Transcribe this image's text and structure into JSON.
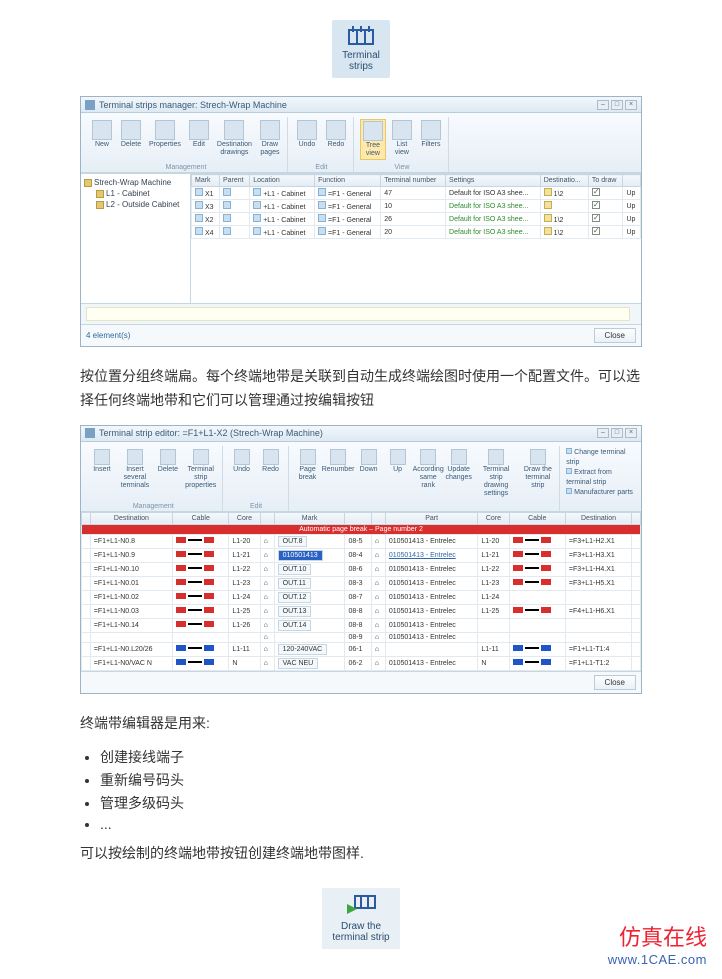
{
  "top_icon": {
    "label": "Terminal\nstrips"
  },
  "manager": {
    "title": "Terminal strips manager: Strech-Wrap Machine",
    "ribbon": {
      "groups": [
        {
          "label": "Management",
          "buttons": [
            {
              "label": "New"
            },
            {
              "label": "Delete"
            },
            {
              "label": "Properties"
            },
            {
              "label": "Edit"
            },
            {
              "label": "Destination\ndrawings"
            },
            {
              "label": "Draw\npages"
            }
          ]
        },
        {
          "label": "Edit",
          "buttons": [
            {
              "label": "Undo"
            },
            {
              "label": "Redo"
            }
          ]
        },
        {
          "label": "View",
          "buttons": [
            {
              "label": "Tree\nview",
              "highlight": true
            },
            {
              "label": "List\nview"
            },
            {
              "label": "Filters"
            }
          ]
        }
      ]
    },
    "tree": {
      "root": "Strech-Wrap Machine",
      "items": [
        "L1 - Cabinet",
        "L2 - Outside Cabinet"
      ]
    },
    "grid": {
      "headers": [
        "Mark",
        "Parent",
        "Location",
        "Function",
        "Terminal number",
        "Settings",
        "Destinatio...",
        "To draw",
        ""
      ],
      "rows": [
        {
          "mark": "X1",
          "parent": "",
          "location": "+L1 - Cabinet",
          "func": "=F1 - General",
          "tnum": "47",
          "settings": "Default for ISO A3 shee...",
          "dest": "1\\2",
          "chk": true,
          "act": "Up"
        },
        {
          "mark": "X3",
          "parent": "",
          "location": "+L1 - Cabinet",
          "func": "=F1 - General",
          "tnum": "10",
          "settings": "Default for ISO A3 shee...",
          "dest": "",
          "chk": true,
          "act": "Up",
          "green": true
        },
        {
          "mark": "X2",
          "parent": "",
          "location": "+L1 - Cabinet",
          "func": "=F1 - General",
          "tnum": "26",
          "settings": "Default for ISO A3 shee...",
          "dest": "1\\2",
          "chk": true,
          "act": "Up",
          "green": true
        },
        {
          "mark": "X4",
          "parent": "",
          "location": "+L1 - Cabinet",
          "func": "=F1 - General",
          "tnum": "20",
          "settings": "Default for ISO A3 shee...",
          "dest": "1\\2",
          "chk": true,
          "act": "Up",
          "green": true
        }
      ]
    },
    "footer": {
      "count": "4 element(s)",
      "close": "Close"
    }
  },
  "para1": "按位置分组终端扁。每个终端地带是关联到自动生成终端绘图时使用一个配置文件。可以选择任何终端地带和它们可以管理通过按编辑按钮",
  "editor": {
    "title": "Terminal strip editor: =F1+L1-X2 (Strech-Wrap Machine)",
    "ribbon": {
      "groups": [
        {
          "label": "Management",
          "buttons": [
            {
              "label": "Insert"
            },
            {
              "label": "Insert several\nterminals"
            },
            {
              "label": "Delete"
            },
            {
              "label": "Terminal strip\nproperties"
            }
          ]
        },
        {
          "label": "Edit",
          "buttons": [
            {
              "label": "Undo"
            },
            {
              "label": "Redo"
            }
          ]
        },
        {
          "label": "",
          "buttons": [
            {
              "label": "Page\nbreak"
            },
            {
              "label": "Renumber"
            },
            {
              "label": "Down"
            },
            {
              "label": "Up"
            },
            {
              "label": "According\nsame rank"
            },
            {
              "label": "Update\nchanges"
            },
            {
              "label": "Terminal strip\ndrawing settings"
            },
            {
              "label": "Draw the\nterminal strip"
            }
          ]
        }
      ],
      "side": [
        "Change terminal strip",
        "Extract from terminal strip",
        "Manufacturer parts"
      ]
    },
    "headers": [
      "",
      "Destination",
      "Cable",
      "Core",
      "",
      "Mark",
      "",
      "",
      "Part",
      "Core",
      "Cable",
      "Destination",
      ""
    ],
    "redrow": "Automatic page break – Page number 2",
    "rows": [
      {
        "d": "=F1+L1-N0.8",
        "c": "L1-20",
        "m": "OUT.8",
        "n": "08-5",
        "p": "010501413 - Entrelec",
        "c2": "L1-20",
        "d2": "=F3+L1-H2.X1"
      },
      {
        "d": "=F1+L1-N0.9",
        "c": "L1-21",
        "m": "010501413",
        "n": "08-4",
        "p": "010501413 - Entrelec",
        "c2": "L1-21",
        "d2": "=F3+L1-H3.X1",
        "sel": true
      },
      {
        "d": "=F1+L1-N0.10",
        "c": "L1-22",
        "m": "OUT.10",
        "n": "08-6",
        "p": "010501413 - Entrelec",
        "c2": "L1-22",
        "d2": "=F3+L1-H4.X1"
      },
      {
        "d": "=F1+L1-N0.01",
        "c": "L1-23",
        "m": "OUT.11",
        "n": "08-3",
        "p": "010501413 - Entrelec",
        "c2": "L1-23",
        "d2": "=F3+L1-H5.X1"
      },
      {
        "d": "=F1+L1-N0.02",
        "c": "L1-24",
        "m": "OUT.12",
        "n": "08-7",
        "p": "010501413 - Entrelec",
        "c2": "L1-24",
        "d2": ""
      },
      {
        "d": "=F1+L1-N0.03",
        "c": "L1-25",
        "m": "OUT.13",
        "n": "08-8",
        "p": "010501413 - Entrelec",
        "c2": "L1-25",
        "d2": "=F4+L1-H6.X1"
      },
      {
        "d": "=F1+L1-N0.14",
        "c": "L1-26",
        "m": "OUT.14",
        "n": "08-8",
        "p": "010501413 - Entrelec",
        "c2": "",
        "d2": ""
      },
      {
        "d": "",
        "c": "",
        "m": "",
        "n": "08-9",
        "p": "010501413 - Entrelec",
        "c2": "",
        "d2": ""
      },
      {
        "d": "=F1+L1-N0.L20/26",
        "c": "L1-11",
        "m": "120-240VAC",
        "n": "06-1",
        "p": "",
        "c2": "L1-11",
        "d2": "=F1+L1-T1:4",
        "blue": true
      },
      {
        "d": "=F1+L1-N0/VAC N",
        "c": "N",
        "m": "VAC NEU",
        "n": "06-2",
        "p": "010501413 - Entrelec",
        "c2": "N",
        "d2": "=F1+L1-T1:2",
        "blue": true
      }
    ],
    "close": "Close"
  },
  "para2": "终端带编辑器是用来:",
  "bullets": [
    "创建接线端子",
    "重新编号码头",
    "管理多级码头",
    "..."
  ],
  "para3": "可以按绘制的终端地带按钮创建终端地带图样.",
  "draw_icon": {
    "label": "Draw the\nterminal strip"
  },
  "watermark": {
    "l1": "仿真在线",
    "l2": "www.1CAE.com"
  }
}
